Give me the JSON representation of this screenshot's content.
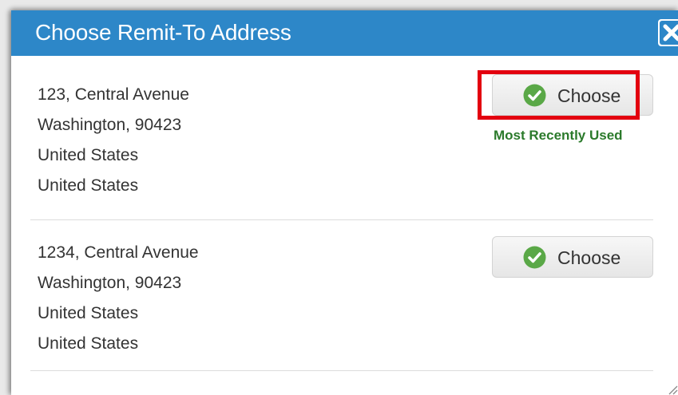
{
  "dialog": {
    "title": "Choose Remit-To Address",
    "close_icon": "close-icon"
  },
  "addresses": [
    {
      "lines": [
        "123, Central Avenue",
        "Washington, 90423",
        "United States",
        "United States"
      ],
      "button_label": "Choose",
      "badge": "Most Recently Used",
      "highlighted": true
    },
    {
      "lines": [
        "1234, Central Avenue",
        "Washington, 90423",
        "United States",
        "United States"
      ],
      "button_label": "Choose",
      "highlighted": false
    }
  ],
  "colors": {
    "header": "#2d87c8",
    "check": "#5aa847",
    "highlight": "#e3000f",
    "badge_text": "#2b7a2b"
  }
}
